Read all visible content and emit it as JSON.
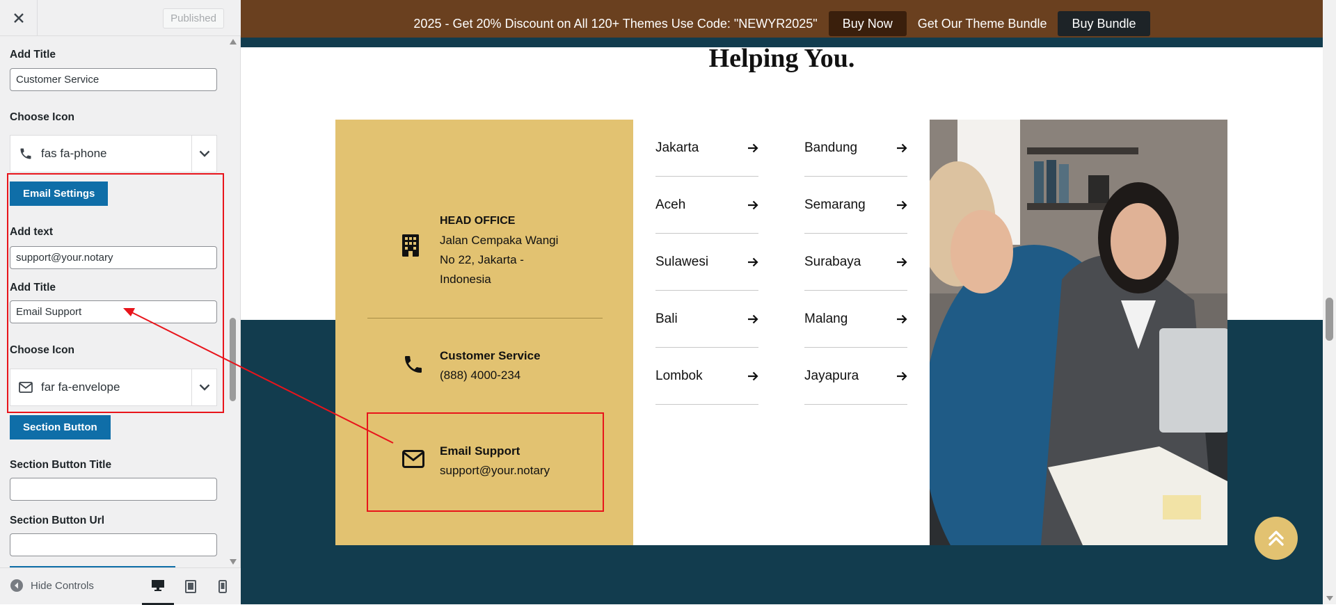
{
  "sidebar": {
    "close_icon": "close-icon",
    "published_label": "Published",
    "phone_section": {
      "title_label": "Add Title",
      "title_value": "Customer Service",
      "icon_label": "Choose Icon",
      "icon_value": "fas fa-phone"
    },
    "email_section": {
      "button_label": "Email Settings",
      "text_label": "Add text",
      "text_value": "support@your.notary",
      "title_label": "Add Title",
      "title_value": "Email Support",
      "icon_label": "Choose Icon",
      "icon_value": "far fa-envelope"
    },
    "section_button": {
      "button_label": "Section Button",
      "title_label": "Section Button Title",
      "title_value": "",
      "url_label": "Section Button Url",
      "url_value": ""
    },
    "footer": {
      "hide_controls_label": "Hide Controls",
      "devices": [
        "desktop",
        "tablet",
        "mobile"
      ]
    }
  },
  "preview": {
    "promo": {
      "text": "2025 - Get 20% Discount on All 120+ Themes Use Code: \"NEWYR2025\"",
      "buy_now": "Buy Now",
      "bundle_text": "Get Our Theme Bundle",
      "buy_bundle": "Buy Bundle"
    },
    "heading": "Helping You.",
    "contacts": {
      "head_office_title": "HEAD OFFICE",
      "head_office_lines": [
        "Jalan Cempaka Wangi",
        "No 22, Jakarta -",
        "Indonesia"
      ],
      "phone_title": "Customer Service",
      "phone_value": "(888) 4000-234",
      "email_title": "Email Support",
      "email_value": "support@your.notary"
    },
    "cities_left": [
      "Jakarta",
      "Aceh",
      "Sulawesi",
      "Bali",
      "Lombok"
    ],
    "cities_right": [
      "Bandung",
      "Semarang",
      "Surabaya",
      "Malang",
      "Jayapura"
    ],
    "colors": {
      "gold": "#e2c271",
      "teal": "#123c4e",
      "promo_brown": "#6a401f",
      "wp_blue": "#0f6ea8",
      "annotation_red": "#e8141b"
    }
  }
}
